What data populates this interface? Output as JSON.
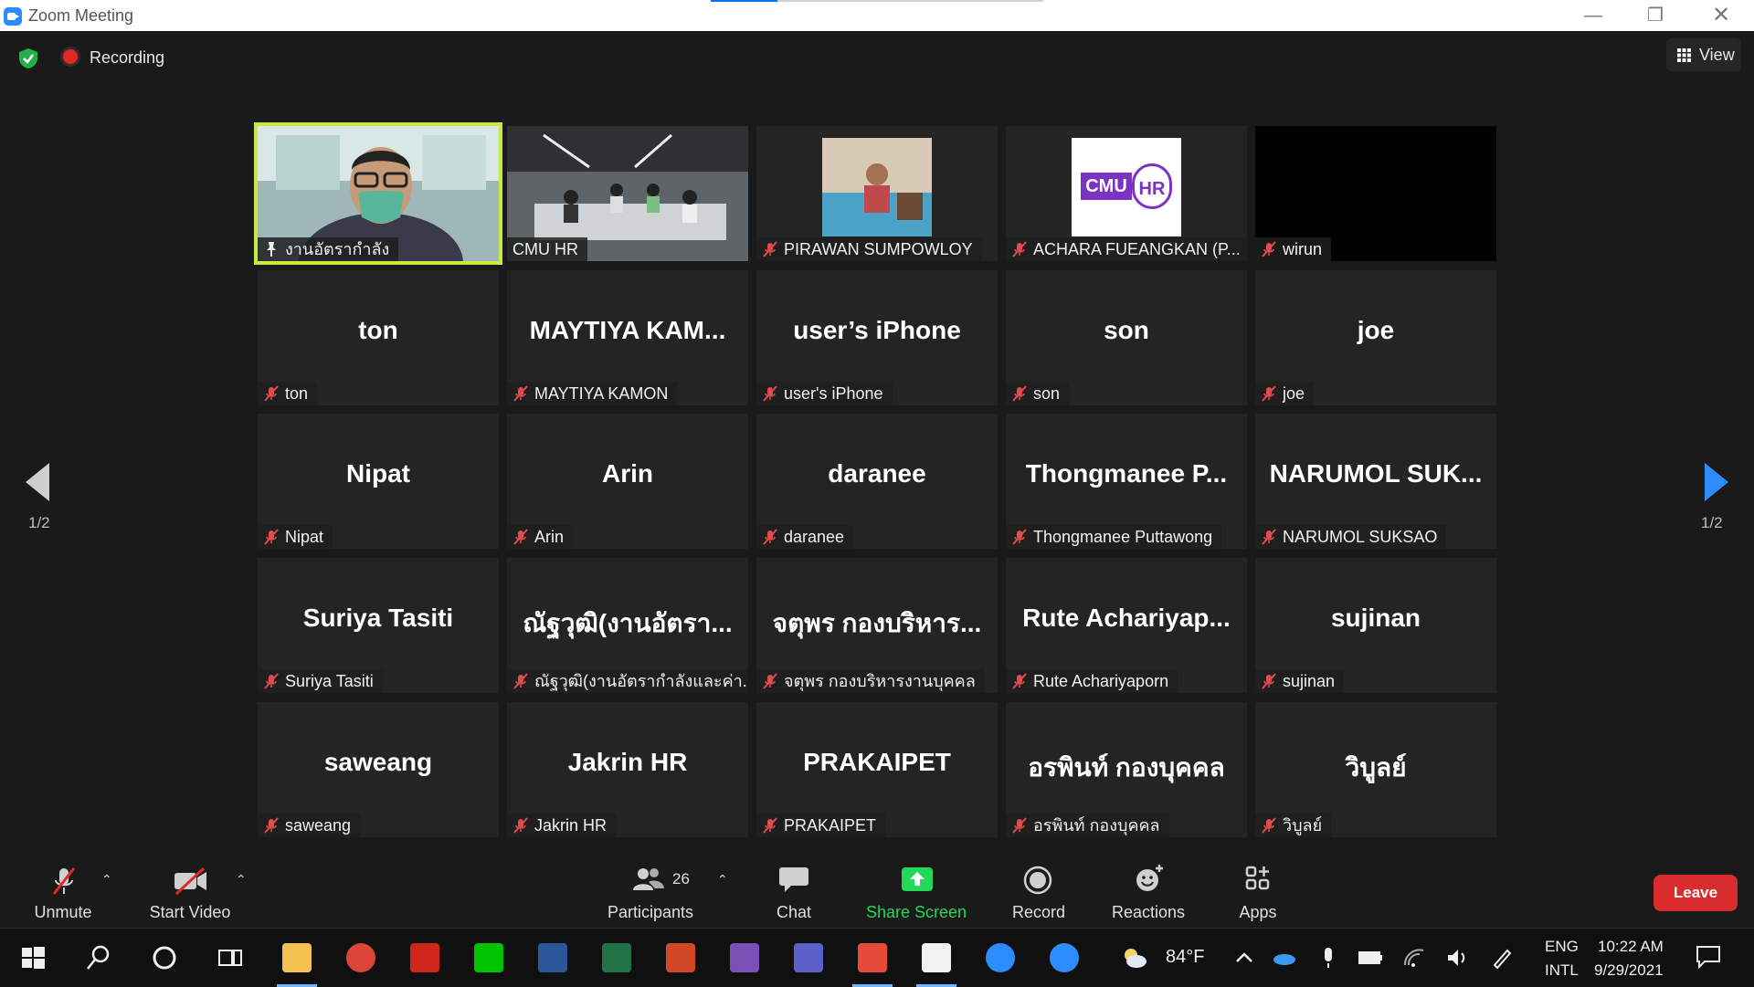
{
  "window": {
    "title": "Zoom Meeting",
    "load_progress": 0.2
  },
  "topbar": {
    "recording_label": "Recording",
    "view_label": "View"
  },
  "pagination": {
    "left": "1/2",
    "right": "1/2"
  },
  "participants": [
    {
      "big": "",
      "name": "งานอัตรากำลัง",
      "mic": "pin",
      "video": "person"
    },
    {
      "big": "",
      "name": "CMU HR",
      "mic": "none",
      "video": "room"
    },
    {
      "big": "",
      "name": "PIRAWAN SUMPOWLOY",
      "mic": "muted",
      "video": "thumb-person"
    },
    {
      "big": "",
      "name": "ACHARA FUEANGKAN (P...",
      "mic": "muted",
      "video": "logo",
      "logo_text_left": "CMU",
      "logo_text_right": "HR"
    },
    {
      "big": "",
      "name": "wirun",
      "mic": "muted",
      "video": "black"
    },
    {
      "big": "ton",
      "name": "ton",
      "mic": "muted"
    },
    {
      "big": "MAYTIYA  KAM...",
      "name": "MAYTIYA KAMON",
      "mic": "muted"
    },
    {
      "big": "user’s iPhone",
      "name": "user's iPhone",
      "mic": "muted"
    },
    {
      "big": "son",
      "name": "son",
      "mic": "muted"
    },
    {
      "big": "joe",
      "name": "joe",
      "mic": "muted"
    },
    {
      "big": "Nipat",
      "name": "Nipat",
      "mic": "muted"
    },
    {
      "big": "Arin",
      "name": "Arin",
      "mic": "muted"
    },
    {
      "big": "daranee",
      "name": "daranee",
      "mic": "muted"
    },
    {
      "big": "Thongmanee  P...",
      "name": "Thongmanee Puttawong",
      "mic": "muted"
    },
    {
      "big": "NARUMOL  SUK...",
      "name": "NARUMOL SUKSAO",
      "mic": "muted"
    },
    {
      "big": "Suriya Tasiti",
      "name": "Suriya Tasiti",
      "mic": "muted"
    },
    {
      "big": "ณัฐวุฒิ(งานอัตรา...",
      "name": "ณัฐวุฒิ(งานอัตรากำลังและค่า...",
      "mic": "muted"
    },
    {
      "big": "จตุพร กองบริหาร...",
      "name": "จตุพร กองบริหารงานบุคคล",
      "mic": "muted"
    },
    {
      "big": "Rute  Achariyap...",
      "name": "Rute Achariyaporn",
      "mic": "muted"
    },
    {
      "big": "sujinan",
      "name": "sujinan",
      "mic": "muted"
    },
    {
      "big": "saweang",
      "name": "saweang",
      "mic": "muted"
    },
    {
      "big": "Jakrin HR",
      "name": "Jakrin HR",
      "mic": "muted"
    },
    {
      "big": "PRAKAIPET",
      "name": "PRAKAIPET",
      "mic": "muted"
    },
    {
      "big": "อรพินท์ กองบุคคล",
      "name": "อรพินท์ กองบุคคล",
      "mic": "muted"
    },
    {
      "big": "วิบูลย์",
      "name": "วิบูลย์",
      "mic": "muted"
    }
  ],
  "toolbar": {
    "unmute": "Unmute",
    "start_video": "Start Video",
    "participants": "Participants",
    "participants_count": "26",
    "chat": "Chat",
    "share_screen": "Share Screen",
    "record": "Record",
    "reactions": "Reactions",
    "apps": "Apps",
    "leave": "Leave",
    "share_color": "#23d959",
    "leave_color": "#d92c2c"
  },
  "taskbar": {
    "weather": "84°F",
    "lang_top": "ENG",
    "lang_bottom": "INTL",
    "time": "10:22 AM",
    "date": "9/29/2021",
    "apps": [
      "start-icon",
      "search-icon",
      "cortana-icon",
      "task-view-icon",
      "file-explorer-icon",
      "chrome-icon",
      "acrobat-icon",
      "line-icon",
      "word-icon",
      "excel-icon",
      "powerpoint-icon",
      "onenote-icon",
      "teams-icon",
      "zoom-icon",
      "notepad-icon",
      "edge-icon",
      "help-icon"
    ]
  }
}
